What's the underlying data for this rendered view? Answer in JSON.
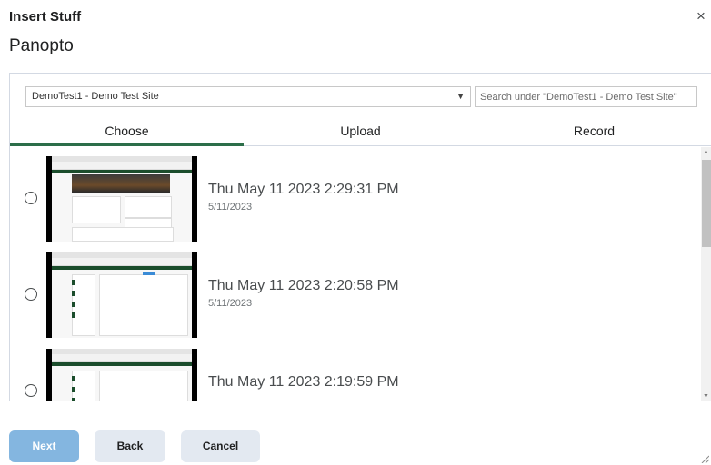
{
  "dialog": {
    "title": "Insert Stuff",
    "close_glyph": "×",
    "subtitle": "Panopto"
  },
  "filters": {
    "site_selected": "DemoTest1 - Demo Test Site",
    "search_placeholder": "Search under \"DemoTest1 - Demo Test Site\""
  },
  "tabs": [
    {
      "label": "Choose",
      "active": true
    },
    {
      "label": "Upload",
      "active": false
    },
    {
      "label": "Record",
      "active": false
    }
  ],
  "items": [
    {
      "title": "Thu May 11 2023 2:29:31 PM",
      "date": "5/11/2023"
    },
    {
      "title": "Thu May 11 2023 2:20:58 PM",
      "date": "5/11/2023"
    },
    {
      "title": "Thu May 11 2023 2:19:59 PM",
      "date": ""
    }
  ],
  "buttons": {
    "next": "Next",
    "back": "Back",
    "cancel": "Cancel"
  },
  "colors": {
    "accent_tab": "#2c6e49",
    "next_button": "#84b6e0",
    "secondary_button": "#e3e9f1"
  },
  "icons": {
    "close": "close-icon",
    "dropdown": "chevron-down-icon",
    "resize": "resize-handle-icon"
  }
}
